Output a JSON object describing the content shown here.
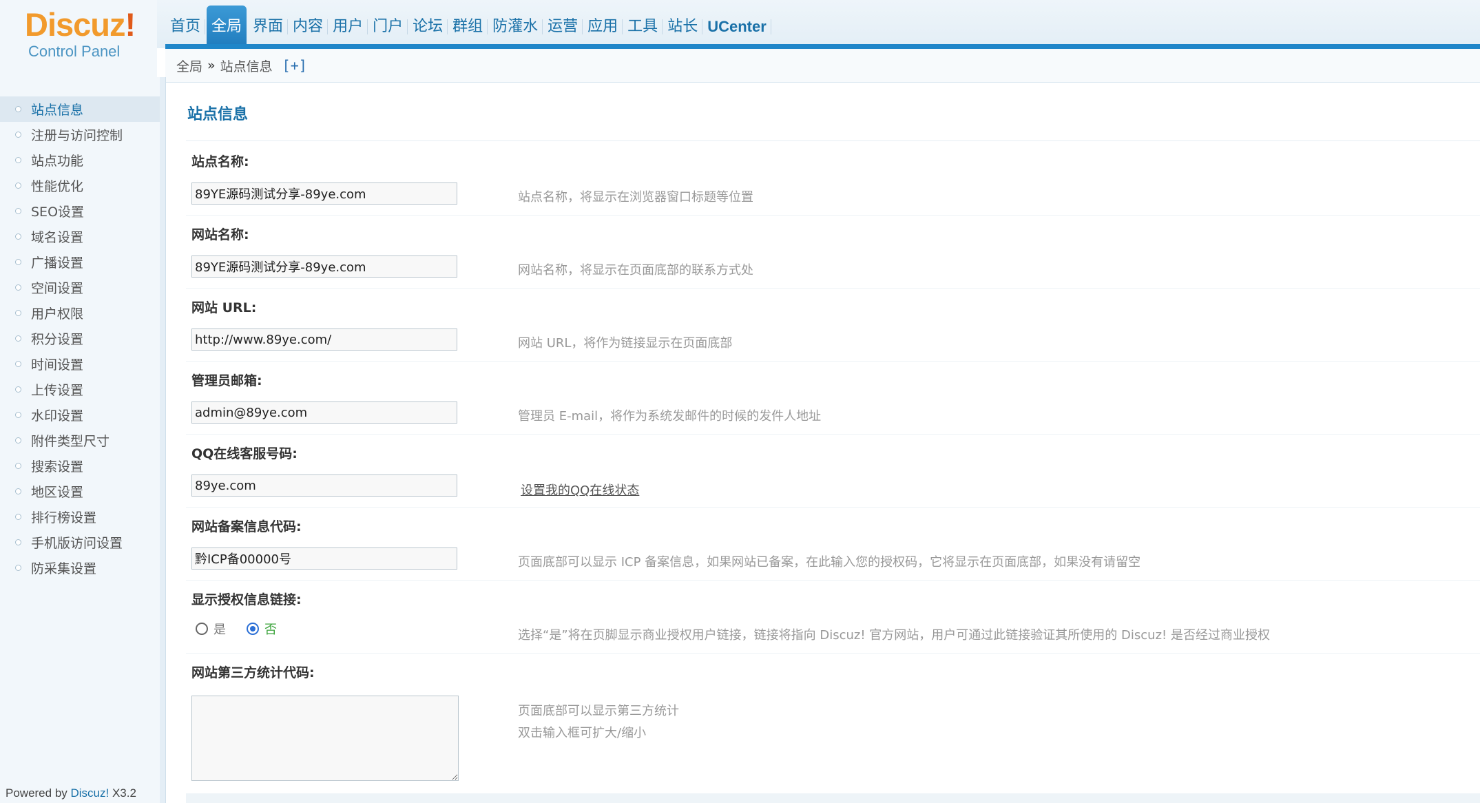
{
  "logo": {
    "brand": "Discuz",
    "bang": "!",
    "sub": "Control Panel"
  },
  "topnav": [
    {
      "label": "首页"
    },
    {
      "label": "全局",
      "active": true
    },
    {
      "label": "界面"
    },
    {
      "label": "内容"
    },
    {
      "label": "用户"
    },
    {
      "label": "门户"
    },
    {
      "label": "论坛"
    },
    {
      "label": "群组"
    },
    {
      "label": "防灌水"
    },
    {
      "label": "运营"
    },
    {
      "label": "应用"
    },
    {
      "label": "工具"
    },
    {
      "label": "站长"
    },
    {
      "label": "UCenter"
    }
  ],
  "breadcrumb": {
    "root": "全局",
    "sep": "»",
    "current": "站点信息",
    "add": "[+]"
  },
  "sidebar": {
    "items": [
      {
        "label": "站点信息",
        "active": true
      },
      {
        "label": "注册与访问控制"
      },
      {
        "label": "站点功能"
      },
      {
        "label": "性能优化"
      },
      {
        "label": "SEO设置"
      },
      {
        "label": "域名设置"
      },
      {
        "label": "广播设置"
      },
      {
        "label": "空间设置"
      },
      {
        "label": "用户权限"
      },
      {
        "label": "积分设置"
      },
      {
        "label": "时间设置"
      },
      {
        "label": "上传设置"
      },
      {
        "label": "水印设置"
      },
      {
        "label": "附件类型尺寸"
      },
      {
        "label": "搜索设置"
      },
      {
        "label": "地区设置"
      },
      {
        "label": "排行榜设置"
      },
      {
        "label": "手机版访问设置"
      },
      {
        "label": "防采集设置"
      }
    ],
    "powered": {
      "prefix": "Powered by ",
      "link": "Discuz!",
      "version": " X3.2"
    }
  },
  "main": {
    "title": "站点信息",
    "fields": {
      "site_name": {
        "label": "站点名称:",
        "value": "89YE源码测试分享-89ye.com",
        "tip": "站点名称，将显示在浏览器窗口标题等位置"
      },
      "web_name": {
        "label": "网站名称:",
        "value": "89YE源码测试分享-89ye.com",
        "tip": "网站名称，将显示在页面底部的联系方式处"
      },
      "url": {
        "label": "网站 URL:",
        "value": "http://www.89ye.com/",
        "tip": "网站 URL，将作为链接显示在页面底部"
      },
      "email": {
        "label": "管理员邮箱:",
        "value": "admin@89ye.com",
        "tip": "管理员 E-mail，将作为系统发邮件的时候的发件人地址"
      },
      "qq": {
        "label": "QQ在线客服号码:",
        "value": "89ye.com",
        "tip": "设置我的QQ在线状态"
      },
      "icp": {
        "label": "网站备案信息代码:",
        "value": "黔ICP备00000号",
        "tip": "页面底部可以显示 ICP 备案信息，如果网站已备案，在此输入您的授权码，它将显示在页面底部，如果没有请留空"
      },
      "license": {
        "label": "显示授权信息链接:",
        "yes": "是",
        "no": "否",
        "selected": "no",
        "tip": "选择“是”将在页脚显示商业授权用户链接，链接将指向 Discuz! 官方网站，用户可通过此链接验证其所使用的 Discuz! 是否经过商业授权"
      },
      "stats": {
        "label": "网站第三方统计代码:",
        "value": "",
        "tip1": "页面底部可以显示第三方统计",
        "tip2": "双击输入框可扩大/缩小"
      }
    }
  }
}
